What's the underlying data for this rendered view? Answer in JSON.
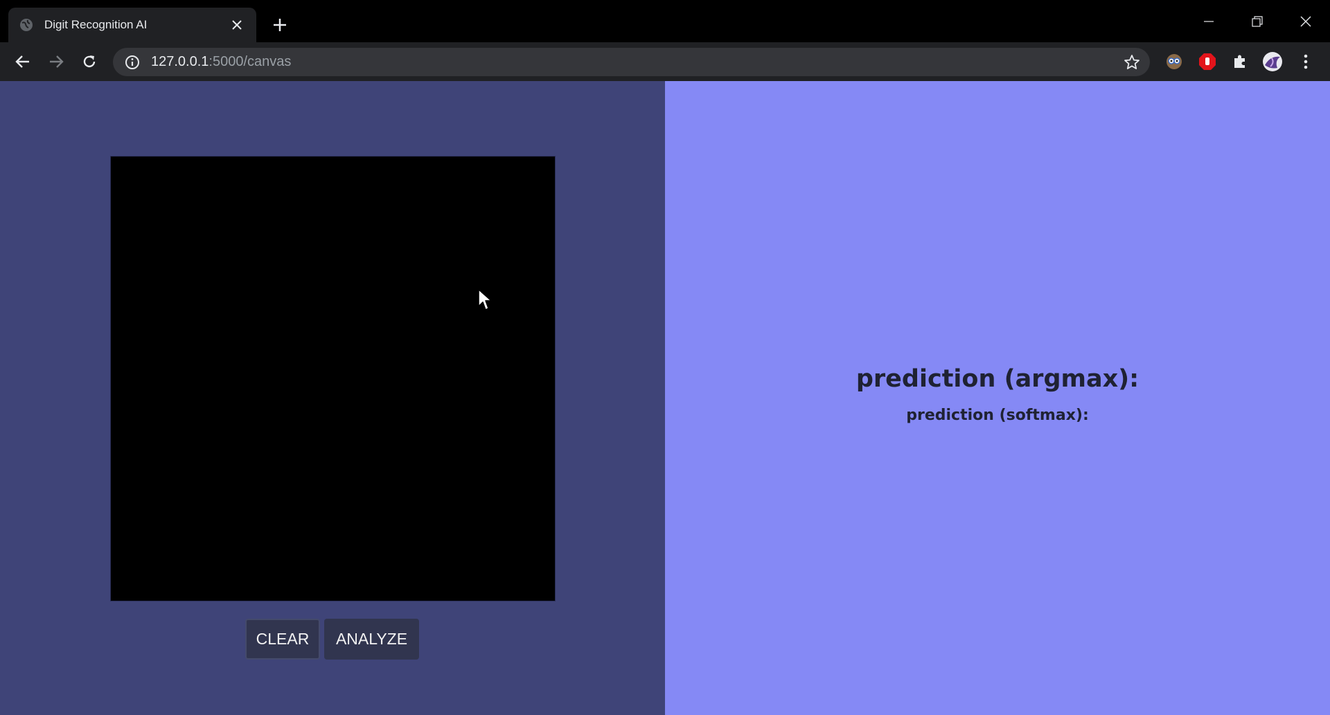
{
  "browser": {
    "tab_title": "Digit Recognition AI",
    "url_host": "127.0.0.1",
    "url_path": ":5000/canvas"
  },
  "canvas": {
    "background": "#000000"
  },
  "controls": {
    "clear_label": "CLEAR",
    "analyze_label": "ANALYZE"
  },
  "results": {
    "argmax_label": "prediction (argmax):",
    "softmax_label": "prediction (softmax):"
  },
  "colors": {
    "left_panel": "#3f4478",
    "right_panel": "#8589f5",
    "button": "#31354f"
  }
}
